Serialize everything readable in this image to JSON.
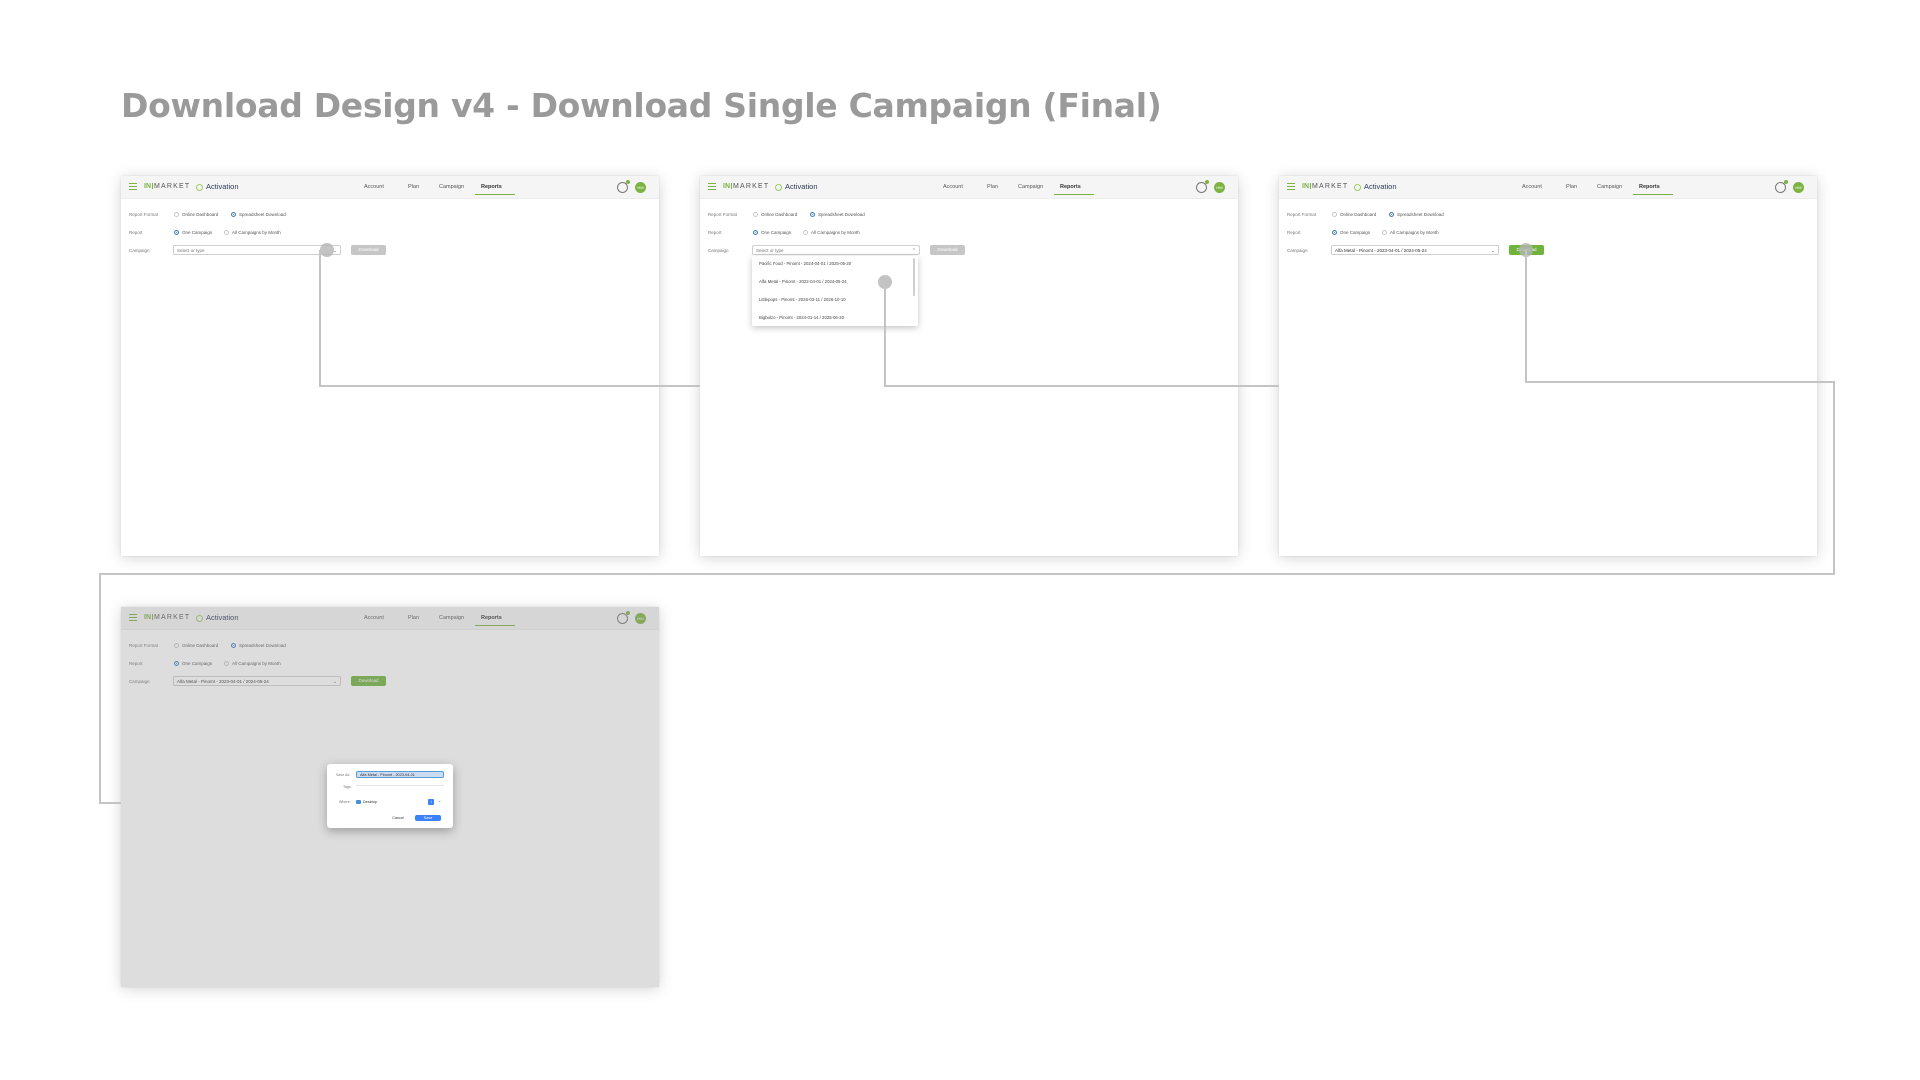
{
  "page": {
    "title": "Download Design v4 - Download Single Campaign (Final)"
  },
  "app": {
    "logo": {
      "mark": "IN",
      "name": "MARKET"
    },
    "product": "Activation",
    "nav": [
      "Account",
      "Plan",
      "Campaign",
      "Reports"
    ],
    "active_nav": "Reports",
    "avatar_initials": "HM"
  },
  "form": {
    "report_format_label": "Report Format",
    "report_label": "Report",
    "campaign_label": "Campaign",
    "format_options": [
      "Online Dashboard",
      "Spreadsheet Download"
    ],
    "report_options": [
      "One Campaign",
      "All Campaigns by Month"
    ],
    "campaign_placeholder": "Select or type",
    "selected_campaign": "Alfa Metal - Pinomt - 2023-04-01 / 2024-05-24",
    "download_label": "Download"
  },
  "dropdown": {
    "items": [
      "Pacific Food - Pinomt - 2024-04-01 / 2025-05-20",
      "Alfa Metal - Pinomt - 2022-04-01 / 2024-05-24",
      "Littlepops - Pinomt - 2026-03-11 / 2026-10-10",
      "Bigbolzo - Pinomt - 2024-01-14 / 2025-06-20"
    ]
  },
  "save_dialog": {
    "save_as_label": "Save As:",
    "tags_label": "Tags:",
    "where_label": "Where:",
    "filename": "Alfa Metal - Pinomt - 2023-04-01",
    "location": "Desktop",
    "cancel_label": "Cancel",
    "save_label": "Save"
  },
  "colors": {
    "brand_green": "#7cb342",
    "download_active": "#6fb23d",
    "download_disabled": "#c6c6c6",
    "radio_selected": "#3e7fc4",
    "dialog_primary": "#3b82f6",
    "connector": "#c4c4c4",
    "title_gray": "#9a9a9a"
  },
  "icons": [
    "menu-icon",
    "location-pin-icon",
    "notification-bell-icon",
    "chevron-down-icon",
    "chevron-up-icon",
    "folder-icon",
    "expand-icon"
  ]
}
